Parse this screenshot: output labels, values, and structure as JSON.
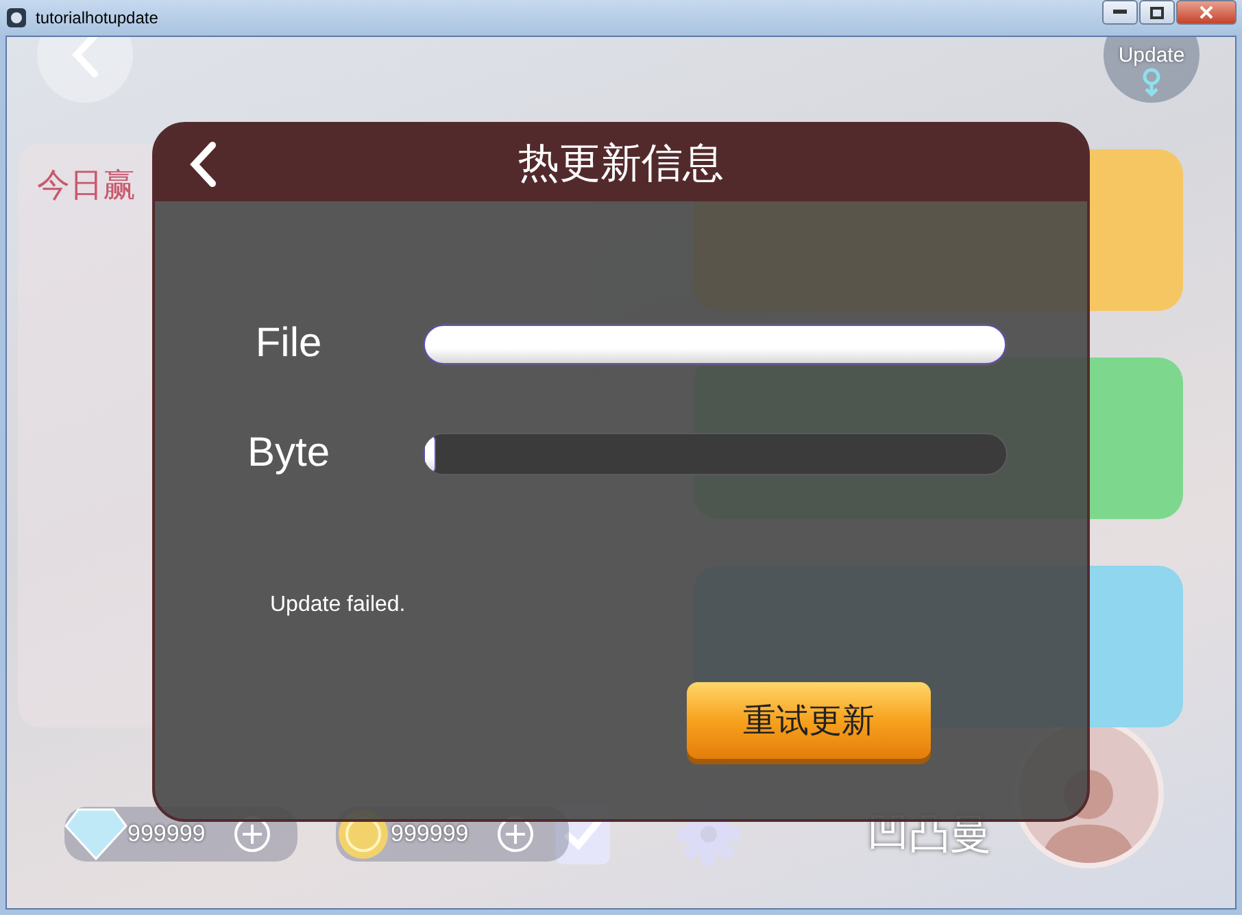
{
  "window": {
    "title": "tutorialhotupdate"
  },
  "top_bar": {
    "update_button": "Update"
  },
  "left_panel": {
    "title": "今日赢"
  },
  "rooms": [
    {
      "color": "#f6c662"
    },
    {
      "color": "#7dd88e"
    },
    {
      "color": "#8fd6ee"
    }
  ],
  "bottom_bar": {
    "diamonds": "999999",
    "coins": "999999",
    "player_name": "凹凸曼"
  },
  "dialog": {
    "title": "热更新信息",
    "progress": [
      {
        "label": "File",
        "level": 1
      },
      {
        "label": "Byte",
        "level": 0.02
      }
    ],
    "status": "Update failed.",
    "retry_button": "重试更新"
  }
}
